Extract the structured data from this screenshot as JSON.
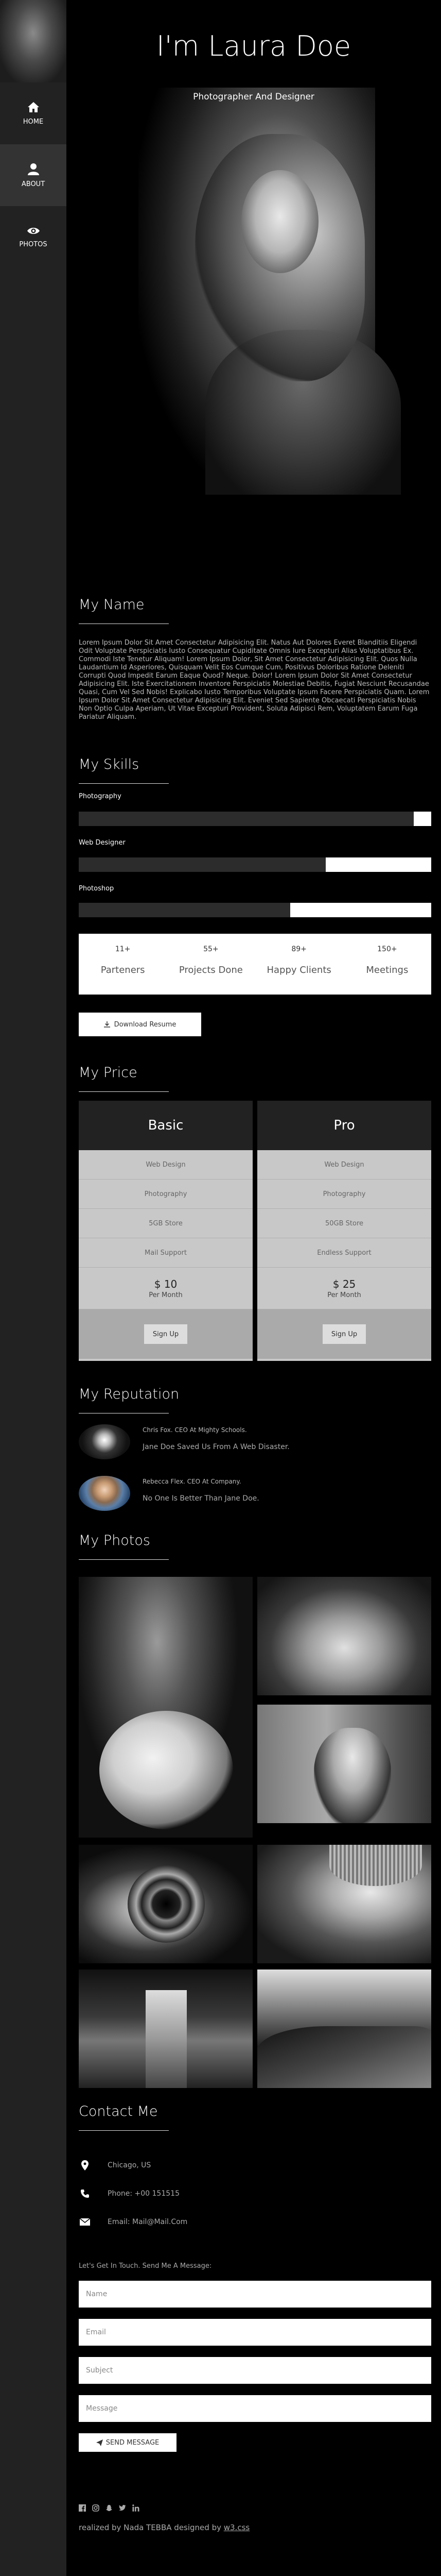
{
  "sidebar": {
    "items": [
      {
        "label": "HOME",
        "icon": "home-icon"
      },
      {
        "label": "ABOUT",
        "icon": "user-icon"
      },
      {
        "label": "PHOTOS",
        "icon": "eye-icon"
      }
    ]
  },
  "hero": {
    "title": "I'm Laura Doe",
    "subtitle": "Photographer And Designer"
  },
  "about": {
    "title": "My Name",
    "text": "Lorem Ipsum Dolor Sit Amet Consectetur Adipisicing Elit. Natus Aut Dolores Everet Blanditiis Eligendi Odit Voluptate Perspiciatis Iusto Consequatur Cupiditate Omnis Iure Excepturi Alias Voluptatibus Ex. Commodi Iste Tenetur Aliquam! Lorem Ipsum Dolor, Sit Amet Consectetur Adipisicing Elit. Quos Nulla Laudantium Id Asperiores, Quisquam Velit Eos Cumque Cum, Positivus Doloribus Ratione Deleniti Corrupti Quod Impedit Earum Eaque Quod? Neque. Dolor! Lorem Ipsum Dolor Sit Amet Consectetur Adipisicing Elit. Iste Exercitationem Inventore Perspiciatis Molestiae Debitis, Fugiat Nesciunt Recusandae Quasi, Cum Vel Sed Nobis! Explicabo Iusto Temporibus Voluptate Ipsum Facere Perspiciatis Quam. Lorem Ipsum Dolor Sit Amet Consectetur Adipisicing Elit. Eveniet Sed Sapiente Obcaecati Perspiciatis Nobis Non Optio Culpa Aperiam, Ut Vitae Excepturi Provident, Soluta Adipisci Rem, Voluptatem Earum Fuga Pariatur Aliquam."
  },
  "skills": {
    "title": "My Skills",
    "items": [
      {
        "label": "Photography",
        "level": 0.95
      },
      {
        "label": "Web Designer",
        "level": 0.7
      },
      {
        "label": "Photoshop",
        "level": 0.6
      }
    ]
  },
  "stats": [
    {
      "num": "11+",
      "label": "Parteners"
    },
    {
      "num": "55+",
      "label": "Projects Done"
    },
    {
      "num": "89+",
      "label": "Happy Clients"
    },
    {
      "num": "150+",
      "label": "Meetings"
    }
  ],
  "resume_button": "Download Resume",
  "pricing": {
    "title": "My Price",
    "plans": [
      {
        "name": "Basic",
        "features": [
          "Web Design",
          "Photography",
          "5GB Store",
          "Mail Support"
        ],
        "price": "$ 10",
        "period": "Per Month",
        "cta": "Sign Up"
      },
      {
        "name": "Pro",
        "features": [
          "Web Design",
          "Photography",
          "50GB Store",
          "Endless Support"
        ],
        "price": "$ 25",
        "period": "Per Month",
        "cta": "Sign Up"
      }
    ]
  },
  "reputation": {
    "title": "My Reputation",
    "items": [
      {
        "name": "Chris Fox. CEO At Mighty Schools.",
        "quote": "Jane Doe Saved Us From A Web Disaster."
      },
      {
        "name": "Rebecca Flex. CEO At Company.",
        "quote": "No One Is Better Than Jane Doe."
      }
    ]
  },
  "photos": {
    "title": "My Photos"
  },
  "contact": {
    "title": "Contact Me",
    "location": "Chicago, US",
    "phone": "Phone: +00 151515",
    "email": "Email: Mail@Mail.Com",
    "form_label": "Let's Get In Touch. Send Me A Message:",
    "placeholders": {
      "name": "Name",
      "email": "Email",
      "subject": "Subject",
      "message": "Message"
    },
    "send_button": "SEND MESSAGE"
  },
  "footer": {
    "text": "realized by Nada TEBBA designed by ",
    "link": "w3.css"
  }
}
